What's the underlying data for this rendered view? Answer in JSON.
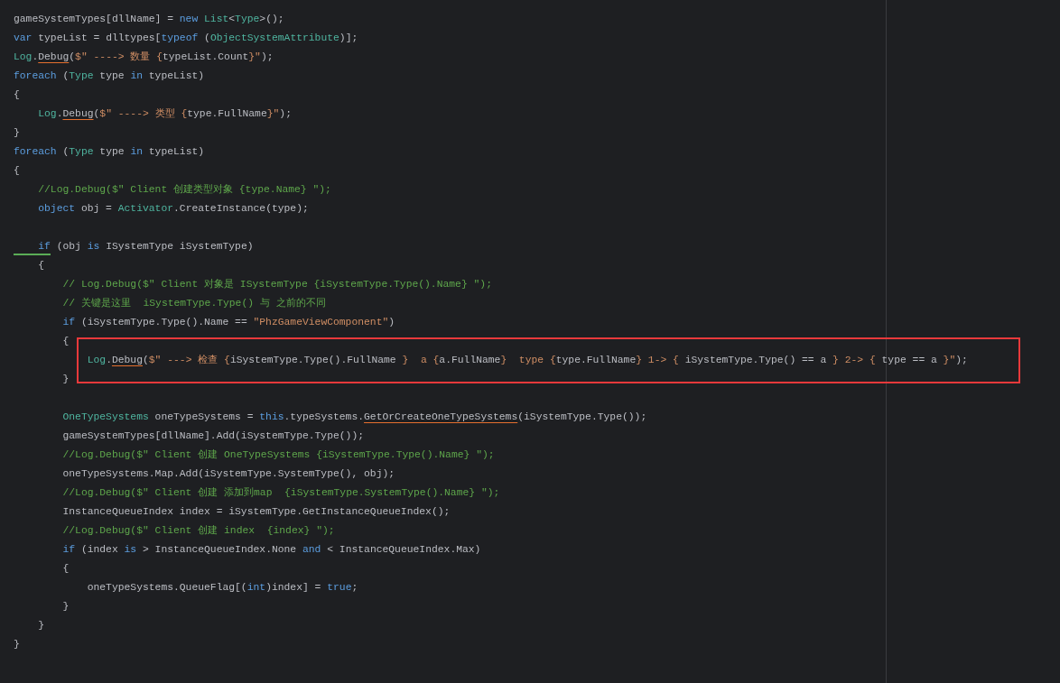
{
  "editor": {
    "lines": [
      {
        "kind": "code",
        "segments": [
          {
            "text": "gameSystemTypes[dllName] = ",
            "kind": "plain"
          },
          {
            "text": "new",
            "kind": "keyword"
          },
          {
            "text": " List",
            "kind": "type"
          },
          {
            "text": "<",
            "kind": "plain"
          },
          {
            "text": "Type",
            "kind": "type"
          },
          {
            "text": ">();",
            "kind": "plain"
          }
        ]
      },
      {
        "kind": "code",
        "segments": [
          {
            "text": "var",
            "kind": "keyword"
          },
          {
            "text": " typeList = dlltypes[",
            "kind": "plain"
          },
          {
            "text": "typeof",
            "kind": "keyword"
          },
          {
            "text": " (",
            "kind": "plain"
          },
          {
            "text": "ObjectSystemAttribute",
            "kind": "type"
          },
          {
            "text": ")];",
            "kind": "plain"
          }
        ]
      },
      {
        "kind": "code",
        "segments": [
          {
            "text": "Log",
            "kind": "type"
          },
          {
            "text": ".",
            "kind": "plain"
          },
          {
            "text": "Debug",
            "kind": "warning"
          },
          {
            "text": "(",
            "kind": "plain"
          },
          {
            "text": "$\" ----> 数量 {",
            "kind": "string"
          },
          {
            "text": "typeList.Count",
            "kind": "plain"
          },
          {
            "text": "}\"",
            "kind": "string"
          },
          {
            "text": ");",
            "kind": "plain"
          }
        ]
      },
      {
        "kind": "code",
        "segments": [
          {
            "text": "foreach",
            "kind": "keyword"
          },
          {
            "text": " (",
            "kind": "plain"
          },
          {
            "text": "Type",
            "kind": "type"
          },
          {
            "text": " type ",
            "kind": "plain"
          },
          {
            "text": "in",
            "kind": "keyword"
          },
          {
            "text": " typeList)",
            "kind": "plain"
          }
        ]
      },
      {
        "kind": "code",
        "segments": [
          {
            "text": "{",
            "kind": "plain"
          }
        ]
      },
      {
        "kind": "code",
        "segments": [
          {
            "text": "    Log",
            "kind": "type"
          },
          {
            "text": ".",
            "kind": "plain"
          },
          {
            "text": "Debug",
            "kind": "warning"
          },
          {
            "text": "(",
            "kind": "plain"
          },
          {
            "text": "$\" ----> 类型 {",
            "kind": "string"
          },
          {
            "text": "type.FullName",
            "kind": "plain"
          },
          {
            "text": "}\"",
            "kind": "string"
          },
          {
            "text": ");",
            "kind": "plain"
          }
        ]
      },
      {
        "kind": "code",
        "segments": [
          {
            "text": "}",
            "kind": "plain"
          }
        ]
      },
      {
        "kind": "code",
        "segments": [
          {
            "text": "foreach",
            "kind": "keyword"
          },
          {
            "text": " (",
            "kind": "plain"
          },
          {
            "text": "Type",
            "kind": "type"
          },
          {
            "text": " type ",
            "kind": "plain"
          },
          {
            "text": "in",
            "kind": "keyword"
          },
          {
            "text": " typeList)",
            "kind": "plain"
          }
        ]
      },
      {
        "kind": "code",
        "segments": [
          {
            "text": "{",
            "kind": "plain"
          }
        ]
      },
      {
        "kind": "code",
        "segments": [
          {
            "text": "    //Log.Debug($\" Client 创建类型对象 {type.Name} \");",
            "kind": "comment"
          }
        ]
      },
      {
        "kind": "code",
        "segments": [
          {
            "text": "    object",
            "kind": "keyword"
          },
          {
            "text": " obj = ",
            "kind": "plain"
          },
          {
            "text": "Activator",
            "kind": "type"
          },
          {
            "text": ".CreateInstance(type);",
            "kind": "plain"
          }
        ]
      },
      {
        "kind": "blank"
      },
      {
        "kind": "code",
        "segments": [
          {
            "text": "    if",
            "kind": "keyword-hint"
          },
          {
            "text": " (obj ",
            "kind": "plain"
          },
          {
            "text": "is",
            "kind": "keyword"
          },
          {
            "text": " ISystemType iSystemType)",
            "kind": "plain"
          }
        ]
      },
      {
        "kind": "code",
        "segments": [
          {
            "text": "    {",
            "kind": "plain"
          }
        ]
      },
      {
        "kind": "code",
        "segments": [
          {
            "text": "        // Log.Debug($\" Client 对象是 ISystemType {iSystemType.Type().Name} \");",
            "kind": "comment"
          }
        ]
      },
      {
        "kind": "code",
        "segments": [
          {
            "text": "        // 关键是这里  iSystemType.Type() 与 之前的不同",
            "kind": "comment"
          }
        ]
      },
      {
        "kind": "code",
        "segments": [
          {
            "text": "        if",
            "kind": "keyword"
          },
          {
            "text": " (iSystemType.Type().Name == ",
            "kind": "plain"
          },
          {
            "text": "\"PhzGameViewComponent\"",
            "kind": "string"
          },
          {
            "text": ")",
            "kind": "plain"
          }
        ]
      },
      {
        "kind": "code",
        "segments": [
          {
            "text": "        {",
            "kind": "plain"
          }
        ]
      },
      {
        "kind": "code",
        "highlighted": true,
        "segments": [
          {
            "text": "            Log",
            "kind": "type"
          },
          {
            "text": ".",
            "kind": "plain"
          },
          {
            "text": "Debug",
            "kind": "warning"
          },
          {
            "text": "(",
            "kind": "plain"
          },
          {
            "text": "$\" ---> 检查 {",
            "kind": "string"
          },
          {
            "text": "iSystemType.Type().FullName ",
            "kind": "plain"
          },
          {
            "text": "}  a {",
            "kind": "string"
          },
          {
            "text": "a.FullName",
            "kind": "plain"
          },
          {
            "text": "}  type {",
            "kind": "string"
          },
          {
            "text": "type.FullName",
            "kind": "plain"
          },
          {
            "text": "} 1-> { ",
            "kind": "string"
          },
          {
            "text": "iSystemType.Type() == a ",
            "kind": "plain"
          },
          {
            "text": "} 2-> { ",
            "kind": "string"
          },
          {
            "text": "type == a ",
            "kind": "plain"
          },
          {
            "text": "}\"",
            "kind": "string"
          },
          {
            "text": ");",
            "kind": "plain"
          }
        ]
      },
      {
        "kind": "code",
        "segments": [
          {
            "text": "        }",
            "kind": "plain"
          }
        ]
      },
      {
        "kind": "blank"
      },
      {
        "kind": "code",
        "segments": [
          {
            "text": "        OneTypeSystems",
            "kind": "type"
          },
          {
            "text": " oneTypeSystems = ",
            "kind": "plain"
          },
          {
            "text": "this",
            "kind": "keyword"
          },
          {
            "text": ".typeSystems.",
            "kind": "plain"
          },
          {
            "text": "GetOrCreateOneTypeSystems",
            "kind": "warning"
          },
          {
            "text": "(iSystemType.Type());",
            "kind": "plain"
          }
        ]
      },
      {
        "kind": "code",
        "segments": [
          {
            "text": "        gameSystemTypes[dllName].Add(iSystemType.Type());",
            "kind": "plain"
          }
        ]
      },
      {
        "kind": "code",
        "segments": [
          {
            "text": "        //Log.Debug($\" Client 创建 OneTypeSystems {iSystemType.Type().Name} \");",
            "kind": "comment"
          }
        ]
      },
      {
        "kind": "code",
        "segments": [
          {
            "text": "        oneTypeSystems.Map.Add(iSystemType.SystemType(), obj);",
            "kind": "plain"
          }
        ]
      },
      {
        "kind": "code",
        "segments": [
          {
            "text": "        //Log.Debug($\" Client 创建 添加到map  {iSystemType.SystemType().Name} \");",
            "kind": "comment"
          }
        ]
      },
      {
        "kind": "code",
        "segments": [
          {
            "text": "        InstanceQueueIndex index = iSystemType.GetInstanceQueueIndex();",
            "kind": "plain"
          }
        ]
      },
      {
        "kind": "code",
        "segments": [
          {
            "text": "        //Log.Debug($\" Client 创建 index  {index} \");",
            "kind": "comment"
          }
        ]
      },
      {
        "kind": "code",
        "segments": [
          {
            "text": "        if",
            "kind": "keyword"
          },
          {
            "text": " (index ",
            "kind": "plain"
          },
          {
            "text": "is",
            "kind": "keyword"
          },
          {
            "text": " > InstanceQueueIndex.None ",
            "kind": "plain"
          },
          {
            "text": "and",
            "kind": "keyword"
          },
          {
            "text": " < InstanceQueueIndex.Max)",
            "kind": "plain"
          }
        ]
      },
      {
        "kind": "code",
        "segments": [
          {
            "text": "        {",
            "kind": "plain"
          }
        ]
      },
      {
        "kind": "code",
        "segments": [
          {
            "text": "            oneTypeSystems.QueueFlag[(",
            "kind": "plain"
          },
          {
            "text": "int",
            "kind": "keyword"
          },
          {
            "text": ")index] = ",
            "kind": "plain"
          },
          {
            "text": "true",
            "kind": "keyword"
          },
          {
            "text": ";",
            "kind": "plain"
          }
        ]
      },
      {
        "kind": "code",
        "segments": [
          {
            "text": "        }",
            "kind": "plain"
          }
        ]
      },
      {
        "kind": "code",
        "segments": [
          {
            "text": "    }",
            "kind": "plain"
          }
        ]
      },
      {
        "kind": "code",
        "segments": [
          {
            "text": "}",
            "kind": "plain"
          }
        ]
      }
    ]
  }
}
